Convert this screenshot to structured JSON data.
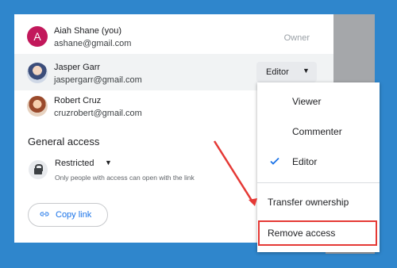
{
  "people": [
    {
      "name": "Aiah Shane (you)",
      "email": "ashane@gmail.com",
      "avatar_letter": "A",
      "role": "Owner"
    },
    {
      "name": "Jasper Garr",
      "email": "jaspergarr@gmail.com",
      "role": "Editor"
    },
    {
      "name": "Robert Cruz",
      "email": "cruzrobert@gmail.com"
    }
  ],
  "general_access": {
    "title": "General access",
    "setting": "Restricted",
    "description": "Only people with access can open with the link"
  },
  "copy_link": "Copy link",
  "menu": {
    "items": [
      "Viewer",
      "Commenter",
      "Editor"
    ],
    "selected": "Editor",
    "transfer": "Transfer ownership",
    "remove": "Remove access"
  },
  "colors": {
    "background": "#2f86cc",
    "accent": "#1a73e8",
    "highlight": "#e53935",
    "avatar": "#c2185b"
  }
}
